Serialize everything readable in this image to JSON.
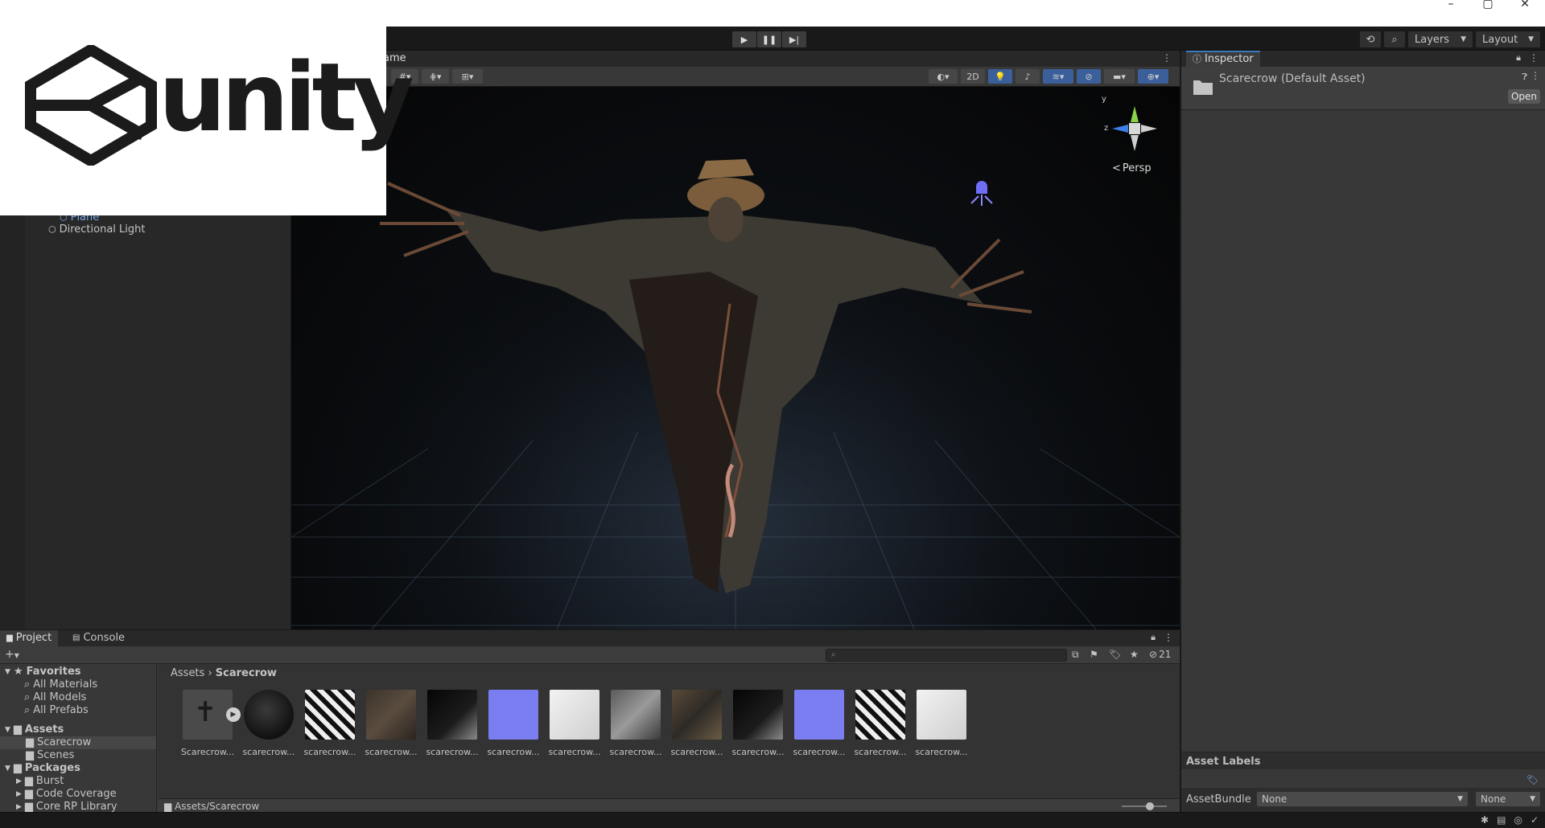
{
  "logo": {
    "text": "unity"
  },
  "titlebar": {
    "icons": [
      "minimize-icon",
      "maximize-icon",
      "close-icon"
    ]
  },
  "toolbar": {
    "play_controls": [
      "play-icon",
      "pause-icon",
      "step-icon"
    ],
    "layers_label": "Layers",
    "layout_label": "Layout"
  },
  "hierarchy": {
    "items": [
      {
        "label": "Plane",
        "selected": true
      },
      {
        "label": "Directional Light",
        "selected": false
      }
    ]
  },
  "scene": {
    "tab_label": "ame",
    "toggle_2d": "2D",
    "gizmo": {
      "y": "y",
      "z": "z",
      "projection": "Persp"
    }
  },
  "inspector": {
    "tab_label": "Inspector",
    "title": "Scarecrow (Default Asset)",
    "open_label": "Open",
    "asset_labels_title": "Asset Labels",
    "asset_bundle_label": "AssetBundle",
    "asset_bundle_value": "None",
    "asset_variant_value": "None"
  },
  "project": {
    "tabs": [
      {
        "label": "Project",
        "active": true
      },
      {
        "label": "Console",
        "active": false
      }
    ],
    "hidden_count": "21",
    "breadcrumb": {
      "root": "Assets",
      "current": "Scarecrow"
    },
    "favorites": {
      "title": "Favorites",
      "items": [
        "All Materials",
        "All Models",
        "All Prefabs"
      ]
    },
    "assets_tree": {
      "title": "Assets",
      "items": [
        "Scarecrow",
        "Scenes"
      ]
    },
    "packages_tree": {
      "title": "Packages",
      "items": [
        "Burst",
        "Code Coverage",
        "Core RP Library"
      ]
    },
    "assets": [
      {
        "name": "Scarecrow...",
        "kind": "prefab"
      },
      {
        "name": "scarecrow...",
        "kind": "material"
      },
      {
        "name": "scarecrow...",
        "kind": "mask"
      },
      {
        "name": "scarecrow...",
        "kind": "albedo"
      },
      {
        "name": "scarecrow...",
        "kind": "dark-mask"
      },
      {
        "name": "scarecrow...",
        "kind": "normal"
      },
      {
        "name": "scarecrow...",
        "kind": "light"
      },
      {
        "name": "scarecrow...",
        "kind": "grey"
      },
      {
        "name": "scarecrow...",
        "kind": "albedo2"
      },
      {
        "name": "scarecrow...",
        "kind": "dark-mask"
      },
      {
        "name": "scarecrow...",
        "kind": "normal"
      },
      {
        "name": "scarecrow...",
        "kind": "mask"
      },
      {
        "name": "scarecrow...",
        "kind": "light"
      }
    ],
    "path": "Assets/Scarecrow"
  },
  "colors": {
    "accent_blue": "#3a79bb",
    "normal_map": "#7b7ef0",
    "panel": "#383838",
    "background": "#191919"
  }
}
